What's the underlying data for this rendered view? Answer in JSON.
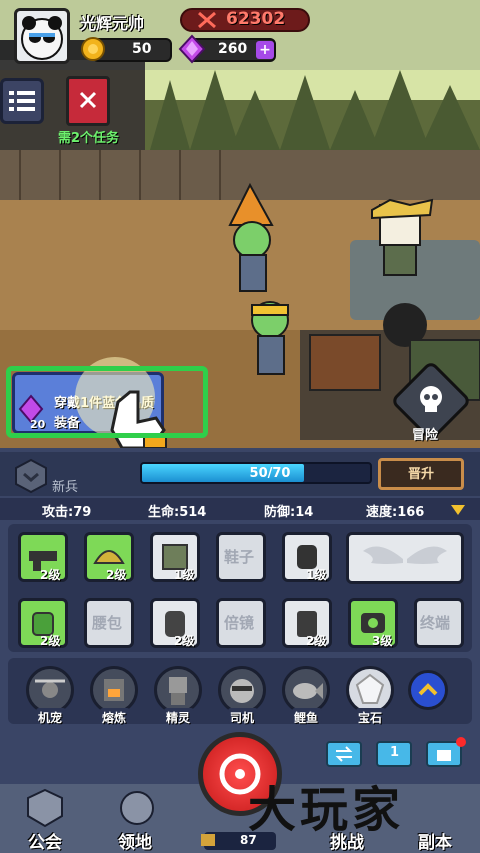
{
  "player": {
    "name": "光辉元帅",
    "power": "62302"
  },
  "resources": {
    "gold": "50",
    "gems": "260"
  },
  "task": {
    "label": "需2个任务"
  },
  "quest": {
    "text": "穿戴1件蓝色品质装备",
    "gem_count": "20"
  },
  "adventure": {
    "label": "冒险"
  },
  "rank": {
    "title": "新兵",
    "xp": "50/70",
    "xp_fraction": 0.71,
    "upgrade_label": "晋升"
  },
  "stats": {
    "attack": "攻击:79",
    "hp": "生命:514",
    "defense": "防御:14",
    "speed": "速度:166"
  },
  "equipment_row1": [
    {
      "level": "2级",
      "icon": "gun-icon"
    },
    {
      "level": "2级",
      "icon": "helmet-icon"
    },
    {
      "level": "1级",
      "icon": "armor-icon"
    },
    {
      "name": "鞋子"
    },
    {
      "level": "1级",
      "icon": "glove-icon"
    }
  ],
  "equipment_row2": [
    {
      "level": "2级",
      "icon": "grenade-icon"
    },
    {
      "name": "腰包"
    },
    {
      "level": "2级",
      "icon": "backpack-icon"
    },
    {
      "name": "倍镜"
    },
    {
      "level": "2级",
      "icon": "jerrycan-icon"
    },
    {
      "level": "3级",
      "icon": "scope-icon"
    },
    {
      "name": "终端"
    }
  ],
  "companions": [
    {
      "label": "机宠"
    },
    {
      "label": "熔炼"
    },
    {
      "label": "精灵"
    },
    {
      "label": "司机"
    },
    {
      "label": "鲤鱼"
    },
    {
      "label": "宝石"
    }
  ],
  "utility": {
    "lock_count": "1"
  },
  "nav": {
    "guild": "公会",
    "territory": "领地",
    "challenge": "挑战",
    "dungeon": "副本"
  },
  "stamina": {
    "value": "87"
  },
  "watermark": "大玩家",
  "colors": {
    "accent_green": "#2fcf4a",
    "power_red": "#ff7a6b",
    "xp_blue": "#4ad6ff"
  }
}
